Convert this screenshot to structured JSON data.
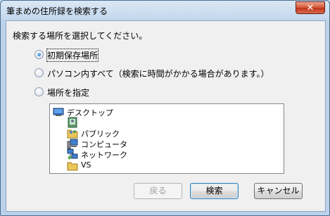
{
  "window": {
    "title": "筆まめの住所録を検索する",
    "close_label": "✕"
  },
  "prompt": "検索する場所を選択してください。",
  "options": [
    {
      "label": "初期保存場所",
      "checked": true
    },
    {
      "label": "パソコン内すべて（検索に時間がかかる場合があります。）",
      "checked": false
    },
    {
      "label": "場所を指定",
      "checked": false
    }
  ],
  "tree": {
    "items": [
      {
        "label": "デスクトップ",
        "icon": "desktop-icon"
      },
      {
        "label": "",
        "icon": "user-folder-icon"
      },
      {
        "label": "パブリック",
        "icon": "public-folder-icon"
      },
      {
        "label": "コンピュータ",
        "icon": "computer-icon"
      },
      {
        "label": "ネットワーク",
        "icon": "network-icon"
      },
      {
        "label": "VS",
        "icon": "folder-icon"
      }
    ]
  },
  "buttons": {
    "back": "戻る",
    "search": "検索",
    "cancel": "キャンセル"
  }
}
